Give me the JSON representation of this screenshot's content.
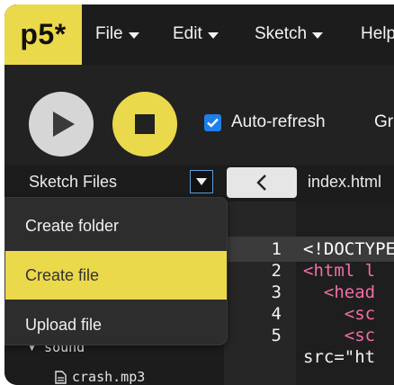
{
  "app": {
    "logo_text": "p5*"
  },
  "nav": {
    "menus": [
      {
        "label": "File"
      },
      {
        "label": "Edit"
      },
      {
        "label": "Sketch"
      },
      {
        "label": "Help"
      }
    ]
  },
  "toolbar": {
    "auto_refresh_label": "Auto-refresh",
    "auto_refresh_checked": true,
    "truncated_label": "Gr"
  },
  "files": {
    "title": "Sketch Files",
    "tab_name": "index.html"
  },
  "dropdown": {
    "items": [
      {
        "label": "Create folder"
      },
      {
        "label": "Create file"
      },
      {
        "label": "Upload file"
      }
    ],
    "active_index": 1
  },
  "tree": {
    "items": [
      {
        "label": "▾ sound"
      },
      {
        "label": "crash.mp3"
      }
    ]
  },
  "editor": {
    "line_numbers": [
      "1",
      "2",
      "3",
      "4",
      "5"
    ],
    "lines": [
      {
        "text": "<!DOCTYPE",
        "color": "#ffffff"
      },
      {
        "text": "<html l",
        "color": "#f06ea5"
      },
      {
        "text": "  <head",
        "color": "#f06ea5"
      },
      {
        "text": "    <sc",
        "color": "#f06ea5"
      },
      {
        "text": "    <sc",
        "color": "#f06ea5"
      }
    ],
    "wrap_text": "src=\"ht"
  },
  "colors": {
    "accent": "#ebd94c",
    "background": "#1c1c1c",
    "checkbox": "#1f7ee8"
  }
}
